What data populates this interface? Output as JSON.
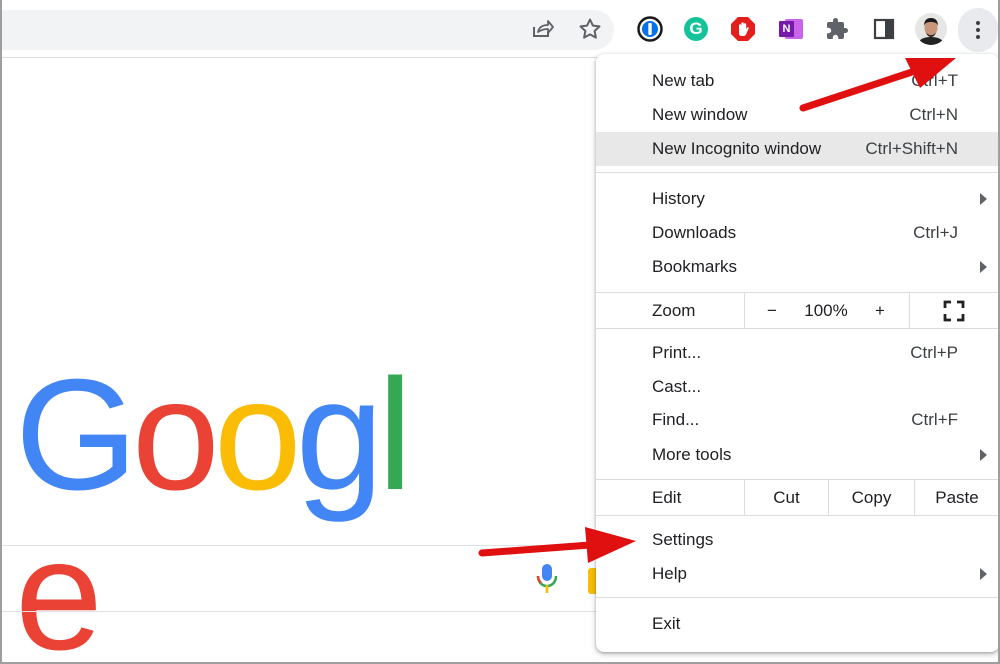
{
  "toolbar": {
    "icons": [
      "share-icon",
      "star-icon",
      "onepassword-icon",
      "grammarly-icon",
      "adblock-icon",
      "onenote-icon",
      "extensions-icon",
      "side-panel-icon",
      "avatar",
      "kebab-menu-icon"
    ],
    "grammarly_letter": "G",
    "onenote_letter": "N"
  },
  "google_logo": {
    "letters": [
      "G",
      "o",
      "o",
      "g",
      "l",
      "e"
    ],
    "colors": [
      "#4285f4",
      "#ea4335",
      "#fbbc05",
      "#4285f4",
      "#34a853",
      "#ea4335"
    ]
  },
  "menu": {
    "new_tab": {
      "label": "New tab",
      "shortcut": "Ctrl+T"
    },
    "new_window": {
      "label": "New window",
      "shortcut": "Ctrl+N"
    },
    "new_incognito": {
      "label": "New Incognito window",
      "shortcut": "Ctrl+Shift+N"
    },
    "history": {
      "label": "History"
    },
    "downloads": {
      "label": "Downloads",
      "shortcut": "Ctrl+J"
    },
    "bookmarks": {
      "label": "Bookmarks"
    },
    "zoom": {
      "label": "Zoom",
      "minus": "−",
      "value": "100%",
      "plus": "+"
    },
    "print": {
      "label": "Print...",
      "shortcut": "Ctrl+P"
    },
    "cast": {
      "label": "Cast..."
    },
    "find": {
      "label": "Find...",
      "shortcut": "Ctrl+F"
    },
    "more_tools": {
      "label": "More tools"
    },
    "edit": {
      "label": "Edit",
      "cut": "Cut",
      "copy": "Copy",
      "paste": "Paste"
    },
    "settings": {
      "label": "Settings"
    },
    "help": {
      "label": "Help"
    },
    "exit": {
      "label": "Exit"
    }
  },
  "colors": {
    "annotation_arrow": "#e01010",
    "highlight_row": "#e8e8e8"
  }
}
